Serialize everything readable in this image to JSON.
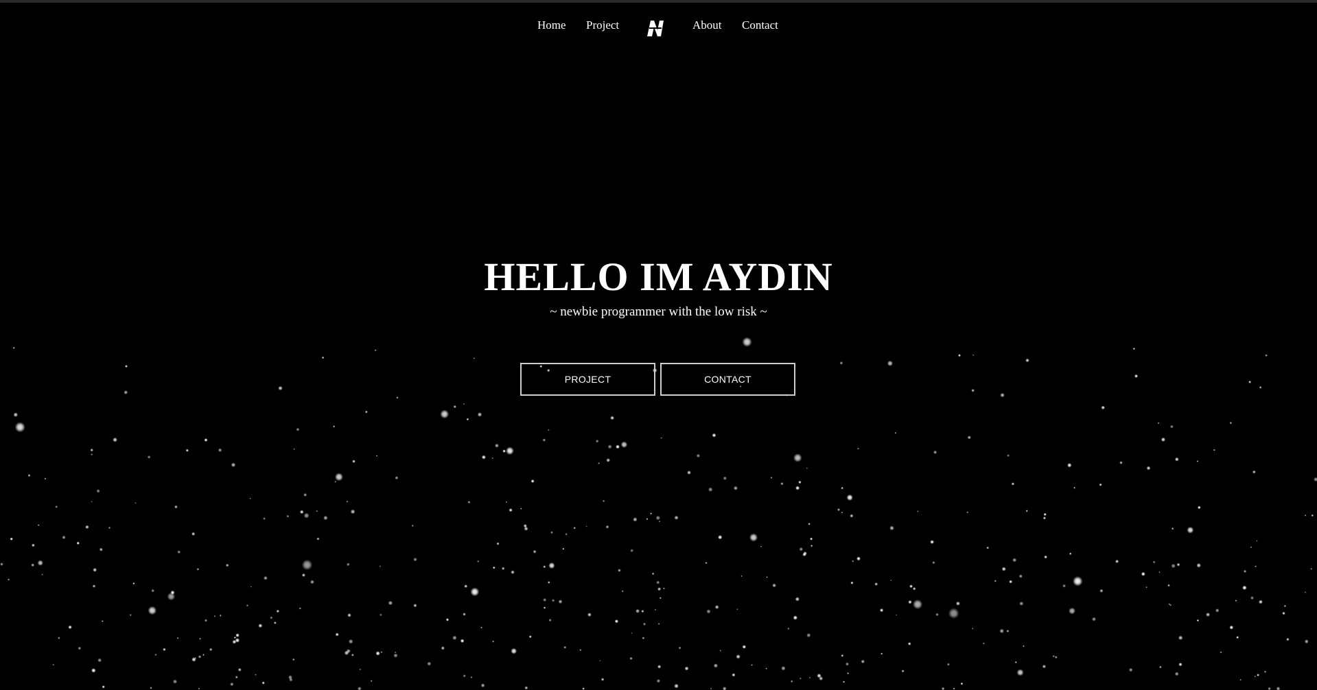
{
  "nav": {
    "items": [
      {
        "label": "Home"
      },
      {
        "label": "Project"
      },
      {
        "label": "About"
      },
      {
        "label": "Contact"
      }
    ],
    "logo_icon": "stylized-n-logo-icon"
  },
  "hero": {
    "title": "HELLO IM AYDIN",
    "subtitle": "~ newbie programmer with the low risk ~"
  },
  "buttons": {
    "project_label": "PROJECT",
    "contact_label": "CONTACT"
  },
  "theme": {
    "background": "#000000",
    "text": "#ffffff",
    "button_border": "#cfcfcf",
    "star": "#ffffff"
  },
  "background": {
    "effect": "starfield-particles"
  }
}
